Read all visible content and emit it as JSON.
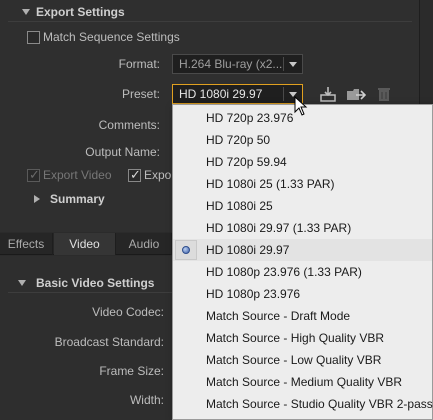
{
  "export_settings": {
    "title": "Export Settings",
    "match_sequence_label": "Match Sequence Settings",
    "format_label": "Format:",
    "format_value": "H.264 Blu-ray (x2...",
    "preset_label": "Preset:",
    "preset_value": "HD 1080i 29.97",
    "comments_label": "Comments:",
    "output_name_label": "Output Name:",
    "export_video_label": "Export Video",
    "export_audio_label": "Expor",
    "summary_label": "Summary"
  },
  "tabs": [
    {
      "label": "Effects"
    },
    {
      "label": "Video"
    },
    {
      "label": "Audio"
    }
  ],
  "basic_video": {
    "title": "Basic Video Settings",
    "video_codec_label": "Video Codec:",
    "broadcast_standard_label": "Broadcast Standard:",
    "frame_size_label": "Frame Size:",
    "width_label": "Width:"
  },
  "preset_dropdown": {
    "items": [
      {
        "label": "HD 720p 23.976"
      },
      {
        "label": "HD 720p 50"
      },
      {
        "label": "HD 720p 59.94"
      },
      {
        "label": "HD 1080i 25 (1.33 PAR)"
      },
      {
        "label": "HD 1080i 25"
      },
      {
        "label": "HD 1080i 29.97 (1.33 PAR)"
      },
      {
        "label": "HD 1080i 29.97"
      },
      {
        "label": "HD 1080p 23.976 (1.33 PAR)"
      },
      {
        "label": "HD 1080p 23.976"
      },
      {
        "label": "Match Source - Draft Mode"
      },
      {
        "label": "Match Source - High Quality VBR"
      },
      {
        "label": "Match Source - Low Quality VBR"
      },
      {
        "label": "Match Source - Medium Quality VBR"
      },
      {
        "label": "Match Source - Studio Quality VBR 2-pass"
      }
    ],
    "selected": "HD 1080i 29.97"
  },
  "icons": {
    "save_preset": "save-preset-icon",
    "import_preset": "import-preset-icon",
    "delete_preset": "trash-icon"
  },
  "colors": {
    "active_border": "#e0a020",
    "panel_bg": "#2f2f2f",
    "menu_bg": "#ededed",
    "radio_blue": "#3a5ea8"
  }
}
